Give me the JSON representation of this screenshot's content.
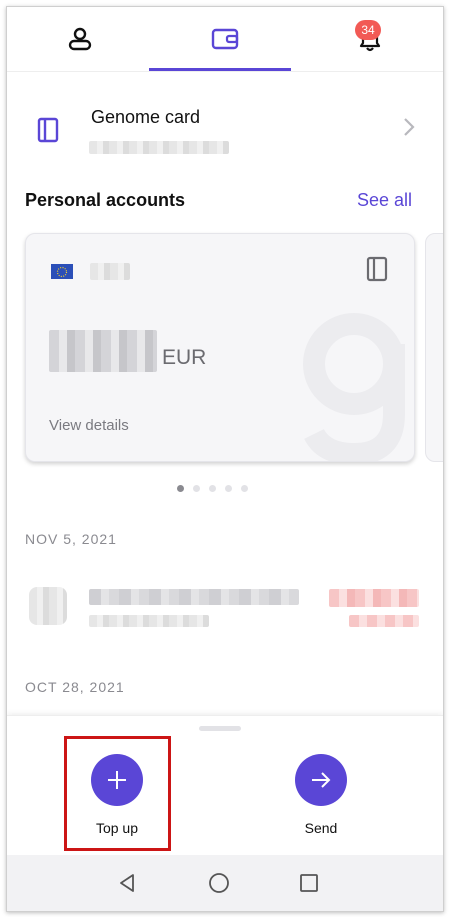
{
  "tabs": [
    {
      "icon": "user-icon"
    },
    {
      "icon": "wallet-icon",
      "active": true
    },
    {
      "icon": "bell-icon",
      "badge": "34"
    }
  ],
  "genome_card": {
    "title": "Genome card",
    "icon": "card-icon"
  },
  "personal_accounts": {
    "title": "Personal accounts",
    "see_all": "See all",
    "account": {
      "currency": "EUR",
      "view_details": "View details"
    },
    "carousel": {
      "count": 5,
      "active": 0
    }
  },
  "transactions": {
    "dates": [
      "NOV 5, 2021",
      "OCT 28, 2021"
    ]
  },
  "actions": [
    {
      "label": "Top up",
      "icon": "plus-icon"
    },
    {
      "label": "Send",
      "icon": "arrow-right-icon"
    }
  ],
  "colors": {
    "accent": "#5a46d6",
    "badge": "#f25a55",
    "highlight": "#cc1515"
  },
  "system_nav": [
    {
      "icon": "back-icon"
    },
    {
      "icon": "home-icon"
    },
    {
      "icon": "recents-icon"
    }
  ]
}
